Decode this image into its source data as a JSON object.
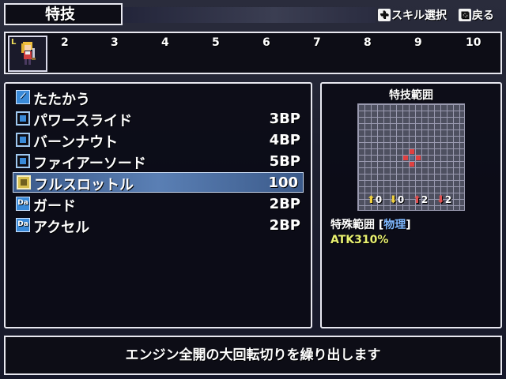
{
  "header": {
    "title": "特技",
    "hint_skill_select": "スキル選択",
    "hint_back": "戻る"
  },
  "party": {
    "slot1_level_marker": "L",
    "slots": [
      "2",
      "3",
      "4",
      "5",
      "6",
      "7",
      "8",
      "9",
      "10"
    ]
  },
  "skills": [
    {
      "name": "たたかう",
      "cost": "",
      "icon": "sword-icon"
    },
    {
      "name": "パワースライド",
      "cost": "3BP",
      "icon": "skill-icon"
    },
    {
      "name": "バーンナウト",
      "cost": "4BP",
      "icon": "skill-icon"
    },
    {
      "name": "ファイアーソード",
      "cost": "5BP",
      "icon": "skill-icon"
    },
    {
      "name": "フルスロットル",
      "cost": "100",
      "icon": "special-icon",
      "selected": true
    },
    {
      "name": "ガード",
      "cost": "2BP",
      "icon": "da-icon"
    },
    {
      "name": "アクセル",
      "cost": "2BP",
      "icon": "da-icon"
    }
  ],
  "da_label": "Da",
  "range_panel": {
    "title": "特技範囲",
    "stats": [
      "0",
      "0",
      "2",
      "2"
    ],
    "range_label": "特殊範囲 [",
    "range_type": "物理",
    "range_close": "]",
    "atk": "ATK310%"
  },
  "colors": {
    "selected_row": "#5a7fb4",
    "range_cells": "#e04040",
    "atk_text": "#e8f070",
    "range_type": "#7fb8ff"
  },
  "description": "エンジン全開の大回転切りを繰り出します"
}
